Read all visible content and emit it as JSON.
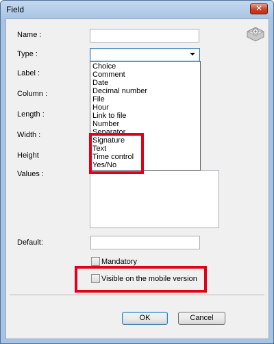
{
  "window": {
    "title": "Field",
    "close_glyph": "✕"
  },
  "form": {
    "name_label": "Name :",
    "type_label": "Type :",
    "label_label": "Label :",
    "column_label": "Column :",
    "length_label": "Length :",
    "width_label": "Width :",
    "height_label": "Height",
    "values_label": "Values :",
    "default_label": "Default:",
    "name_value": "",
    "type_value": "",
    "default_value": ""
  },
  "type_options": [
    "Choice",
    "Comment",
    "Date",
    "Decimal number",
    "File",
    "Hour",
    "Link to file",
    "Number",
    "Separator",
    "Signature",
    "Text",
    "Time control",
    "Yes/No"
  ],
  "checkboxes": {
    "mandatory_label": "Mandatory",
    "mandatory_checked": false,
    "mobile_label": "Visible on the mobile version",
    "mobile_checked": false
  },
  "buttons": {
    "ok": "OK",
    "cancel": "Cancel"
  },
  "highlight_color": "#e0001a",
  "icons": {
    "settings": "gear-icon",
    "close": "close-icon",
    "dropdown": "chevron-down-icon"
  }
}
